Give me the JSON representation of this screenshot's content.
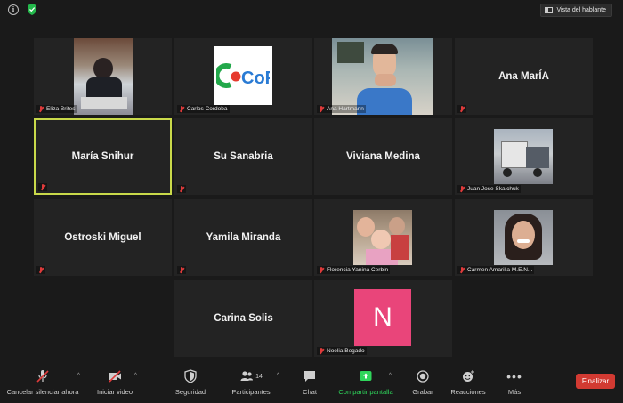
{
  "header": {
    "speaker_view_label": "Vista del hablante"
  },
  "participants": [
    {
      "name": "Eliza Brites",
      "display": ""
    },
    {
      "name": "Carlos Cordoba",
      "display": ""
    },
    {
      "name": "Ana Hartmann",
      "display": ""
    },
    {
      "name": "",
      "display": "Ana MarÍA"
    },
    {
      "name": "",
      "display": "María Snihur"
    },
    {
      "name": "",
      "display": "Su Sanabria"
    },
    {
      "name": "",
      "display": "Viviana Medina"
    },
    {
      "name": "Juan Jose Skalchuk",
      "display": ""
    },
    {
      "name": "",
      "display": "Ostroski Miguel"
    },
    {
      "name": "",
      "display": "Yamila Miranda"
    },
    {
      "name": "Florencia Yanina Cerbin",
      "display": ""
    },
    {
      "name": "Carmen Amarilla M.E.N.I.",
      "display": ""
    },
    {
      "name": "",
      "display": "Carina Solis"
    },
    {
      "name": "Noelia Bogado",
      "display": ""
    }
  ],
  "avatar_letter": "N",
  "logo_text": "CoPI",
  "toolbar": {
    "mute_label": "Cancelar silenciar ahora",
    "video_label": "Iniciar video",
    "security_label": "Seguridad",
    "participants_label": "Participantes",
    "participants_count": "14",
    "chat_label": "Chat",
    "share_label": "Compartir pantalla",
    "record_label": "Grabar",
    "reactions_label": "Reacciones",
    "more_label": "Más",
    "end_label": "Finalizar"
  },
  "colors": {
    "accent_green": "#2fd65b",
    "end_red": "#d23a32",
    "active_border": "#c9d94a",
    "avatar_pink": "#e9457a"
  }
}
